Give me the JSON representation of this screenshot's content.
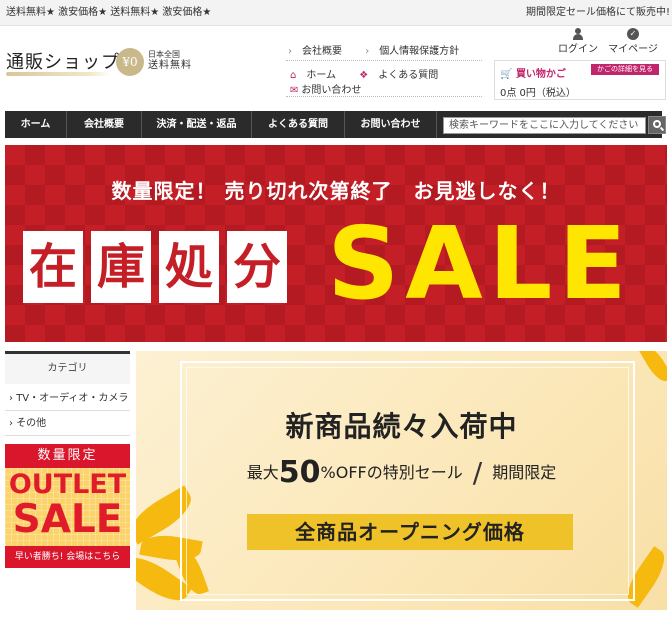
{
  "topbar": {
    "left_text": "送料無料★ 激安価格★ 送料無料★ 激安価格★",
    "right_text": "期間限定セール価格にて販売中!"
  },
  "header": {
    "logo_text": "通販ショップ",
    "zero_badge": "¥0",
    "free_ship_small": "日本全国",
    "free_ship_big": "送料無料",
    "links_row1": [
      "会社概要",
      "個人情報保護方針"
    ],
    "links_row2": [
      "ホーム",
      "よくある質問"
    ],
    "links_row3": [
      "お問い合わせ"
    ],
    "login_label": "ログイン",
    "mypage_label": "マイページ"
  },
  "cart": {
    "title": "買い物かご",
    "detail_button": "かごの詳細を見る",
    "status": "0点 0円（税込）"
  },
  "nav": {
    "items": [
      "ホーム",
      "会社概要",
      "決済・配送・返品",
      "よくある質問",
      "お問い合わせ"
    ],
    "search_placeholder": "検索キーワードをここに入力してください"
  },
  "sale_banner": {
    "tagline": "数量限定！ 売り切れ次第終了　お見逃しなく！",
    "chars": [
      "在",
      "庫",
      "処",
      "分"
    ],
    "sale_word": "SALE",
    "colors": {
      "background": "#c41f26",
      "sale_word": "#ffe600"
    }
  },
  "sidebar": {
    "category_heading": "カテゴリ",
    "items": [
      "TV・オーディオ・カメラ",
      "その他"
    ]
  },
  "outlet": {
    "top_text": "数量限定",
    "word1": "OUTLET",
    "word2": "SALE",
    "bottom_text": "早い者勝ち! 会場はこちら"
  },
  "promo": {
    "headline": "新商品続々入荷中",
    "sub_prefix": "最大",
    "sub_number": "50",
    "sub_suffix": "%OFFの特別セール",
    "sub_slash": "/",
    "sub_limited": "期間限定",
    "price_bar": "全商品オープニング価格"
  }
}
